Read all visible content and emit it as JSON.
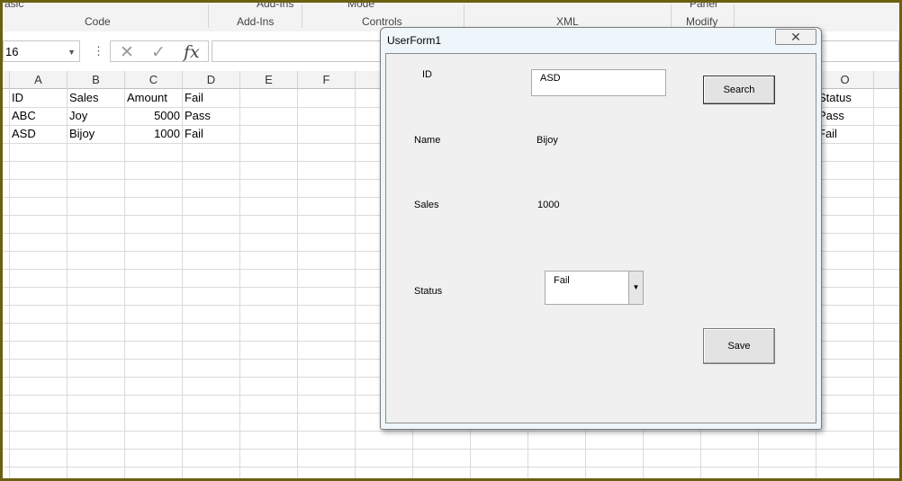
{
  "ribbon": {
    "top_items": [
      "asic",
      "Add-Ins",
      "Mode",
      "Panel"
    ],
    "groups": [
      "Code",
      "Add-Ins",
      "Controls",
      "XML",
      "Modify"
    ]
  },
  "formula_bar": {
    "name_box": "16",
    "dots": "⋮",
    "cancel_glyph": "✕",
    "enter_glyph": "✓",
    "fx_glyph": "fx",
    "formula": ""
  },
  "columns": [
    "A",
    "B",
    "C",
    "D",
    "E",
    "F",
    "O"
  ],
  "sheet": {
    "rows": [
      {
        "A": "ID",
        "B": "Sales",
        "C": "Amount",
        "D": "Fail",
        "O": "Status"
      },
      {
        "A": "ABC",
        "B": "Joy",
        "C": "5000",
        "D": "Pass",
        "O": "Pass"
      },
      {
        "A": "ASD",
        "B": "Bijoy",
        "C": "1000",
        "D": "Fail",
        "O": "Fail"
      }
    ]
  },
  "userform": {
    "title": "UserForm1",
    "close_glyph": "✕",
    "id_label": "ID",
    "id_value": "ASD",
    "search_button": "Search",
    "name_label": "Name",
    "name_value": "Bijoy",
    "sales_label": "Sales",
    "sales_value": "1000",
    "status_label": "Status",
    "status_value": "Fail",
    "status_dropdown_glyph": "▼",
    "save_button": "Save"
  },
  "icons": [
    "chevron-down-icon",
    "more-options-icon",
    "cancel-icon",
    "enter-icon",
    "function-icon",
    "close-icon"
  ],
  "colors": {
    "outer_border": "#6b6010",
    "title_bar": "#eef6fb",
    "form_bg": "#f0f0f0"
  }
}
